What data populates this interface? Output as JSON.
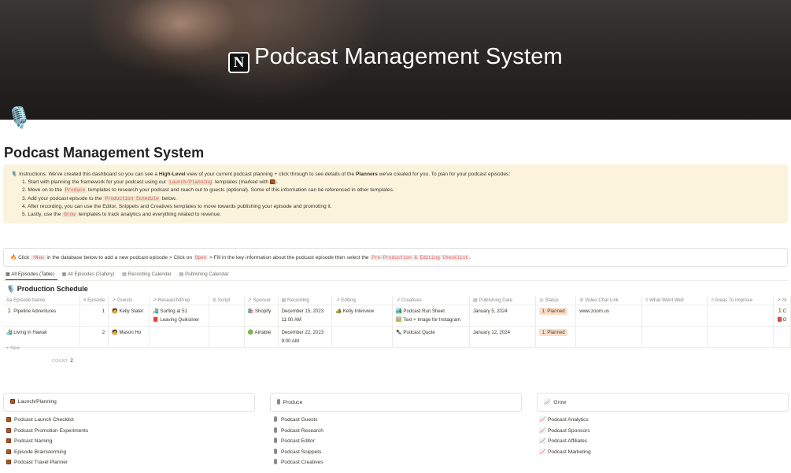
{
  "banner": {
    "title": "Podcast Management System",
    "logo_letter": "N"
  },
  "page": {
    "icon": "🎙️",
    "title": "Podcast Management System"
  },
  "callout": {
    "icon": "🎙️",
    "intro_pre": "Instructions: We've created this dashboard so you can see a ",
    "intro_bold1": "High-Level",
    "intro_mid": " view of your current podcast planning + click through to see details of the ",
    "intro_bold2": "Planners",
    "intro_post": " we've created for you. To plan for your podcast episodes:",
    "s1_pre": "1. Start with planning the framework for your podcast using our ",
    "s1_code": "Launch/Planning",
    "s1_post": " templates (marked with ",
    "s1_end": ").",
    "s2_pre": "2. Move on to the ",
    "s2_code": "Produce",
    "s2_post": " templates to research your podcast and reach out to guests (optional). Some of this information can be referenced in other templates.",
    "s3_pre": "3. Add your podcast episode to the ",
    "s3_code": "Production Schedule",
    "s3_post": " below.",
    "s4": "4. After recording, you can use the Editor, Snippets and Creatives templates to move towards publishing your episode and promoting it.",
    "s5_pre": "5. Lastly, use the ",
    "s5_code": "Grow",
    "s5_post": " templates to track analytics and everything related to revenue."
  },
  "click_callout": {
    "icon": "🔥",
    "t1": "Click ",
    "c1": "+New",
    "t2": " in the database below to add a new podcast episode > Click on ",
    "c2": "Open",
    "t3": " > Fill in the key information about the podcast episode then select the ",
    "c3": "Pre-Production & Editing Checklist",
    "t4": "."
  },
  "views": {
    "all_table": "All Episodes (Table)",
    "all_gallery": "All Episodes (Gallery)",
    "rec_cal": "Recording Calendar",
    "pub_cal": "Publishing Calendar"
  },
  "database": {
    "icon": "🎙️",
    "title": "Production Schedule",
    "columns": [
      "Episode Name",
      "Episode",
      "Guests",
      "Research/Prep.",
      "Script",
      "Sponsor",
      "Recording",
      "Editing",
      "Creatives",
      "Publishing Date",
      "Status",
      "Video Chat Link",
      "What Went Well",
      "Areas To Improve",
      "Sr"
    ],
    "rows": [
      {
        "name": "Pipeline Adventures",
        "name_icon": "🏃",
        "episode": "1",
        "guest": "Kelly Slater",
        "research1": "Surfing at 51",
        "research2": "Leaving Quiksilver",
        "script": "",
        "sponsor": "Shopify",
        "sponsor_icon": "🛍️",
        "rec1": "December 15, 2023",
        "rec2": "11:00 AM",
        "editing": "Kelly Interview",
        "creative1": "Podcast Run Sheet",
        "creative2": "Text + Image for Instagram",
        "pub": "January 5, 2024",
        "status": "1. Planned",
        "link": "www.zoom.us",
        "sr1": "C",
        "sr2": "O"
      },
      {
        "name": "Living in Hawaii",
        "name_icon": "🏄",
        "episode": "2",
        "guest": "Mason Ho",
        "research1": "",
        "research2": "",
        "script": "",
        "sponsor": "Airtable",
        "sponsor_icon": "🟢",
        "rec1": "December 22, 2023",
        "rec2": "9:00 AM",
        "editing": "",
        "creative1": "Podcast Quote",
        "creative2": "",
        "pub": "January 12, 2024",
        "status": "1. Planned",
        "link": "",
        "sr1": "",
        "sr2": ""
      }
    ],
    "new_label": "New",
    "count_label": "COUNT",
    "count_value": "2"
  },
  "sections": {
    "launch": {
      "title": "Launch/Planning",
      "items": [
        "Podcast Launch Checklist",
        "Podcast Promotion Experiments",
        "Podcast Naming",
        "Episode Brainstorming",
        "Podcast Travel Planner"
      ]
    },
    "produce": {
      "title": "Produce",
      "items": [
        "Podcast Guests",
        "Podcast Research",
        "Podcast Editor",
        "Podcast Snippets",
        "Podcast Creatives"
      ]
    },
    "grow": {
      "title": "Grow",
      "items": [
        "Podcast Analytics",
        "Podcast Sponsors",
        "Podcast Affiliates",
        "Podcast Marketing"
      ]
    }
  },
  "colors": {
    "callout_bg": "#fbf3db",
    "status_bg": "#fadec9",
    "code_red": "#eb5757"
  }
}
